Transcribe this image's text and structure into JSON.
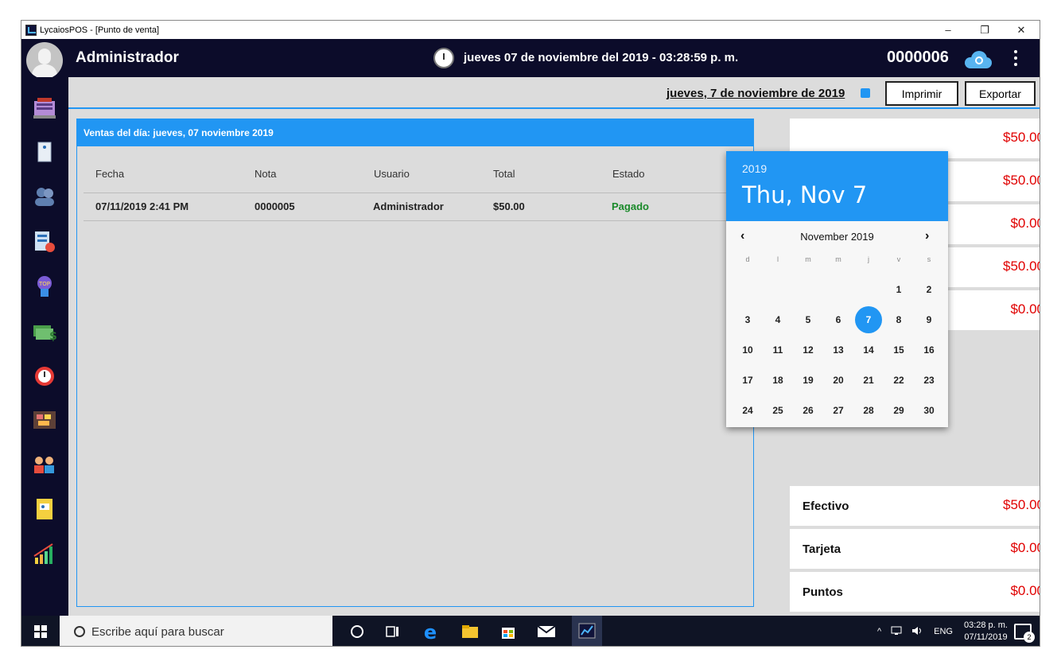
{
  "window": {
    "title": "LycaiosPOS - [Punto de venta]",
    "minimize": "–",
    "restore": "❐",
    "close": "✕"
  },
  "header": {
    "username": "Administrador",
    "datetime": "jueves 07 de noviembre del 2019 - 03:28:59 p. m.",
    "ticket_number": "0000006"
  },
  "toolbar": {
    "date_label": "jueves, 7 de noviembre de 2019",
    "print_label": "Imprimir",
    "export_label": "Exportar"
  },
  "sales": {
    "title": "Ventas del día:  jueves, 07 noviembre 2019",
    "columns": [
      "Fecha",
      "Nota",
      "Usuario",
      "Total",
      "Estado"
    ],
    "rows": [
      {
        "fecha": "07/11/2019 2:41 PM",
        "nota": "0000005",
        "usuario": "Administrador",
        "total": "$50.00",
        "estado": "Pagado"
      }
    ],
    "status_color": "#1a8a2a"
  },
  "summary": {
    "top_values": [
      "$50.00",
      "$50.00",
      "$0.00",
      "$50.00",
      "$0.00"
    ],
    "payments": [
      {
        "label": "Efectivo",
        "value": "$50.00"
      },
      {
        "label": "Tarjeta",
        "value": "$0.00"
      },
      {
        "label": "Puntos",
        "value": "$0.00"
      }
    ],
    "value_color": "#e00000"
  },
  "calendar": {
    "year": "2019",
    "selected_date": "Thu, Nov 7",
    "month_label": "November 2019",
    "days_of_week": [
      "d",
      "l",
      "m",
      "m",
      "j",
      "v",
      "s"
    ],
    "days": [
      "1",
      "2",
      "3",
      "4",
      "5",
      "6",
      "7",
      "8",
      "9",
      "10",
      "11",
      "12",
      "13",
      "14",
      "15",
      "16",
      "17",
      "18",
      "19",
      "20",
      "21",
      "22",
      "23",
      "24",
      "25",
      "26",
      "27",
      "28",
      "29",
      "30"
    ],
    "selected_day": "7",
    "accent": "#2196f3"
  },
  "taskbar": {
    "search_placeholder": "Escribe aquí para buscar",
    "language": "ENG",
    "time": "03:28 p. m.",
    "date": "07/11/2019",
    "notification_count": "2"
  },
  "sidebar_icons": [
    "pos-register-icon",
    "notes-icon",
    "users-icon",
    "reports-clock-icon",
    "top-badge-icon",
    "money-icon",
    "timer-icon",
    "inventory-icon",
    "customers-icon",
    "documents-icon",
    "stats-chart-icon"
  ]
}
